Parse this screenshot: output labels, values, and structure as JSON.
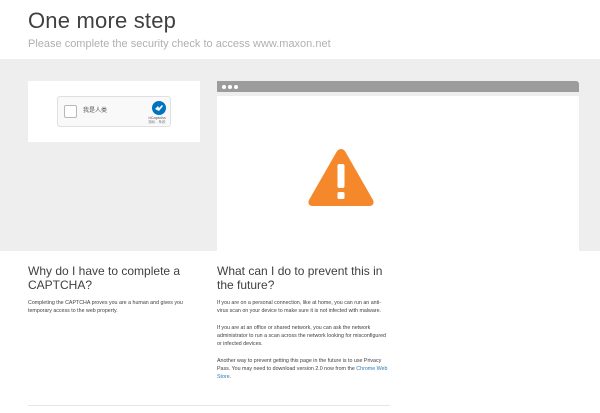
{
  "header": {
    "title": "One more step",
    "subtitle": "Please complete the security check to access www.maxon.net"
  },
  "captcha": {
    "checkbox_label": "我是人类",
    "brand": "hCaptcha",
    "links": "隐私 - 条款"
  },
  "why": {
    "title": "Why do I have to complete a CAPTCHA?",
    "body": "Completing the CAPTCHA proves you are a human and gives you temporary access to the web property."
  },
  "prevent": {
    "title": "What can I do to prevent this in the future?",
    "p1": "If you are on a personal connection, like at home, you can run an anti-virus scan on your device to make sure it is not infected with malware.",
    "p2": "If you are at an office or shared network, you can ask the network administrator to run a scan across the network looking for misconfigured or infected devices.",
    "p3_text": "Another way to prevent getting this page in the future is to use Privacy Pass. You may need to download version 2.0 now from the",
    "p3_link": "Chrome Web Store",
    "p3_end": "."
  },
  "colors": {
    "warning": "#f6882c",
    "link": "#2c7cb0",
    "band": "#eeeeee",
    "browser_chrome": "#9c9c9c"
  },
  "icons": {
    "warning": "warning-triangle-icon",
    "hcaptcha": "hcaptcha-logo-icon"
  }
}
